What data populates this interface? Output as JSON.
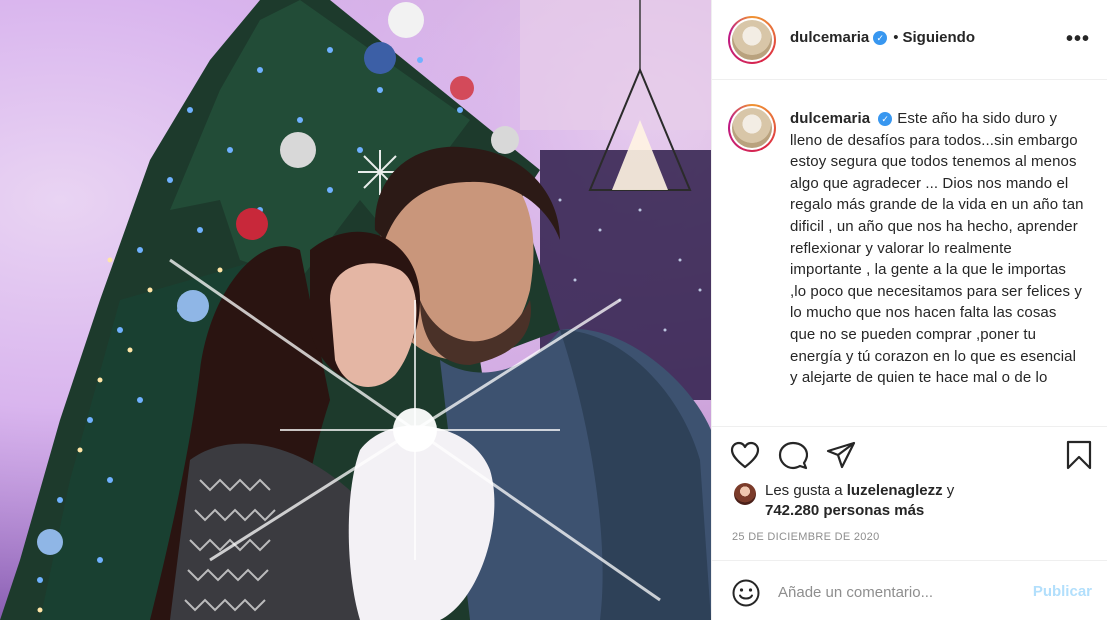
{
  "post": {
    "username": "dulcemaria",
    "follow_status": "Siguiendo",
    "more_label": "•••",
    "caption": "Este año ha sido duro y lleno de desafíos para todos...sin embargo estoy segura que todos tenemos al menos algo que agradecer ... Dios nos mando el regalo más grande de la vida en un año tan dificil , un año que nos ha hecho, aprender reflexionar y valorar lo realmente importante , la gente a la que le importas ,lo poco que necesitamos para ser felices y lo mucho que nos hacen falta las cosas que no se pueden comprar ,poner tu energía y tú corazon en lo que es esencial y alejarte de quien te hace mal o de lo",
    "likes_prefix": "Les gusta a",
    "liked_by": "luzelenaglezz",
    "likes_conjunction": "y",
    "likes_others": "742.280 personas más",
    "date": "25 DE DICIEMBRE DE 2020"
  },
  "comment": {
    "placeholder": "Añade un comentario...",
    "publish_label": "Publicar"
  },
  "colors": {
    "accent_disabled": "#b2dffc",
    "verified": "#3897f0",
    "text": "#262626",
    "muted": "#8e8e8e",
    "divider": "#efefef"
  },
  "icons": {
    "like": "heart-outline-icon",
    "comment": "comment-bubble-icon",
    "share": "paper-plane-icon",
    "save": "bookmark-icon",
    "emoji": "smiley-icon",
    "verified": "verified-badge-icon"
  }
}
